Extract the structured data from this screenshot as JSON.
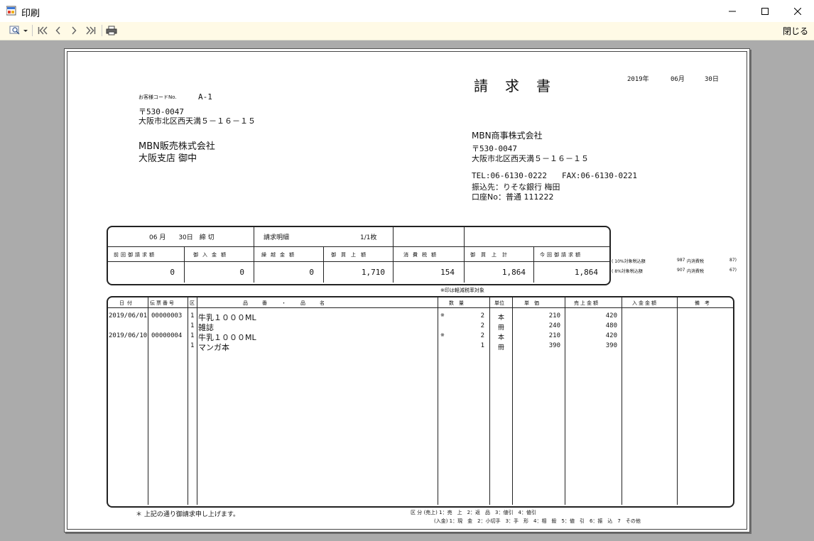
{
  "window": {
    "title": "印刷",
    "minimize": "—",
    "maximize": "☐",
    "close": "✕"
  },
  "toolbar": {
    "close_label": "閉じる",
    "zoom_icon": "magnifier",
    "first_icon": "⏮",
    "prev_icon": "‹",
    "next_icon": "›",
    "last_icon": "⏭",
    "print_icon": "printer"
  },
  "invoice": {
    "title": "請　求　書",
    "date": {
      "year": "2019年",
      "month": "06月",
      "day": "30日"
    },
    "customer": {
      "code_label": "お客様コードNo.",
      "code": "A-1",
      "postal": "〒530-0047",
      "address": "大阪市北区西天満５－１６－１５",
      "name1": "MBN販売株式会社",
      "name2": "大阪支店 御中"
    },
    "issuer": {
      "name": "MBN商事株式会社",
      "postal": "〒530-0047",
      "address": "大阪市北区西天満５－１６－１５",
      "tel": "TEL:06-6130-0222",
      "fax": "FAX:06-6130-0221",
      "bank": "振込先：りそな銀行 梅田",
      "account": "口座No：普通 111222"
    },
    "summary": {
      "closing": "06 月　　30日　締 切",
      "detail_label": "請求明細",
      "page": "1/1枚",
      "headers": [
        "前回御請求額",
        "御入金額",
        "繰越金額",
        "御買上額",
        "消費税額",
        "御買上計",
        "今回御請求額"
      ],
      "values": [
        "0",
        "0",
        "0",
        "1,710",
        "154",
        "1,864",
        "1,864"
      ]
    },
    "tax_notes": [
      {
        "label": "( 10%対象税込額",
        "amount": "987",
        "tax_label": "内消費税",
        "tax": "87)"
      },
      {
        "label": "( 8%対象税込額",
        "amount": "907",
        "tax_label": "内消費税",
        "tax": "67)"
      }
    ],
    "reduced_note": "※印は軽減税率対象",
    "detail": {
      "headers": [
        "日付",
        "伝票番号",
        "区",
        "品　　番　　・　　品　　名",
        "数　量",
        "単位",
        "単　価",
        "売上金額",
        "入金金額",
        "備　考"
      ],
      "rows": [
        {
          "date": "2019/06/01",
          "slip": "00000003",
          "kbn": "1",
          "item": "牛乳１０００ML",
          "mark": "※",
          "qty": "2",
          "unit": "本",
          "price": "210",
          "amount": "420"
        },
        {
          "date": "",
          "slip": "",
          "kbn": "1",
          "item": "雑誌",
          "mark": "",
          "qty": "2",
          "unit": "冊",
          "price": "240",
          "amount": "480"
        },
        {
          "date": "2019/06/10",
          "slip": "00000004",
          "kbn": "1",
          "item": "牛乳１０００ML",
          "mark": "※",
          "qty": "2",
          "unit": "本",
          "price": "210",
          "amount": "420"
        },
        {
          "date": "",
          "slip": "",
          "kbn": "1",
          "item": "マンガ本",
          "mark": "",
          "qty": "1",
          "unit": "冊",
          "price": "390",
          "amount": "390"
        }
      ]
    },
    "footer": {
      "note": "＊ 上記の通り御請求申し上げます。",
      "legend1": "区 分 (売上) 1：売　上　2：返　品　3：値引　4：値引",
      "legend2": "(入金) 1：現　金　2：小切手　3：手　形　4：相　殺　5：値　引　6：振　込　7　その他"
    }
  }
}
